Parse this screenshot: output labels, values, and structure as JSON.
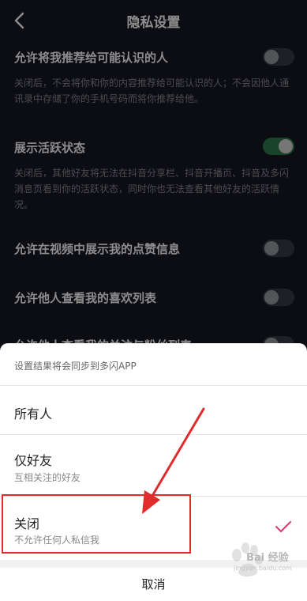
{
  "header": {
    "title": "隐私设置"
  },
  "settings": [
    {
      "title": "允许将我推荐给可能认识的人",
      "desc": "关闭后，不会将你和你的内容推荐给可能认识的人；不会因他人通讯录中存储了你的手机号码而将你推荐给他。",
      "enabled": false
    },
    {
      "title": "展示活跃状态",
      "desc": "关闭后，其他好友将无法在抖音分享栏、抖音开播页、抖音及多闪消息页看到你的活跃状态，同时你也无法查看其他好友的活跃情况。",
      "enabled": true
    },
    {
      "title": "允许在视频中展示我的点赞信息",
      "enabled": false
    },
    {
      "title": "允许他人查看我的喜欢列表",
      "enabled": false
    },
    {
      "title": "允许他人查看我的关注与粉丝列表",
      "enabled": false
    }
  ],
  "sheet": {
    "header": "设置结果将会同步到多闪APP",
    "options": [
      {
        "label": "所有人",
        "sub": ""
      },
      {
        "label": "仅好友",
        "sub": "互相关注的好友"
      },
      {
        "label": "关闭",
        "sub": "不允许任何人私信我",
        "selected": true
      }
    ],
    "cancel": "取消"
  },
  "annotation": {
    "color": "#e02c2c"
  },
  "watermark": {
    "text": "Bai 经验",
    "sub": "jingyan.baidu.com"
  },
  "colors": {
    "accent": "#e0336e",
    "toggle_on": "#2f7d4e",
    "background": "#161823"
  }
}
